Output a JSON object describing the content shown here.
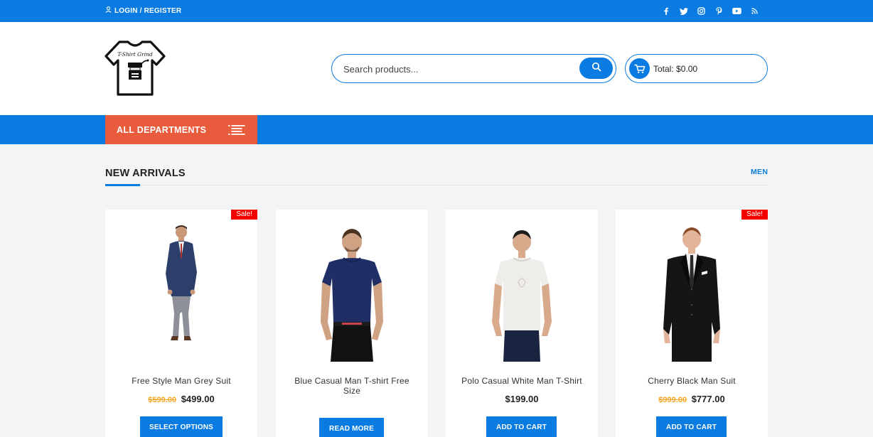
{
  "topbar": {
    "login_label": "LOGIN / REGISTER",
    "social_icons": [
      "facebook-icon",
      "twitter-icon",
      "instagram-icon",
      "pinterest-icon",
      "youtube-icon",
      "rss-icon"
    ]
  },
  "header": {
    "logo_text": "T-Shirt Grind",
    "search": {
      "placeholder": "Search products..."
    },
    "cart": {
      "total_label": "Total: $0.00"
    }
  },
  "nav": {
    "departments_label": "ALL DEPARTMENTS"
  },
  "section": {
    "title": "NEW ARRIVALS",
    "filter_link": "MEN"
  },
  "products": [
    {
      "name": "Free Style Man Grey Suit",
      "old_price": "$599.00",
      "price": "$499.00",
      "badge": "Sale!",
      "button": "SELECT OPTIONS"
    },
    {
      "name": "Blue Casual Man T-shirt Free Size",
      "old_price": "",
      "price": "",
      "badge": "",
      "button": "READ MORE"
    },
    {
      "name": "Polo Casual White Man T-Shirt",
      "old_price": "",
      "price": "$199.00",
      "badge": "",
      "button": "ADD TO CART"
    },
    {
      "name": "Cherry Black Man Suit",
      "old_price": "$999.00",
      "price": "$777.00",
      "badge": "Sale!",
      "button": "ADD TO CART"
    }
  ],
  "colors": {
    "primary": "#0a7be0",
    "departments": "#e85b3c",
    "sale": "#f40000",
    "old_price": "#f5a623"
  }
}
